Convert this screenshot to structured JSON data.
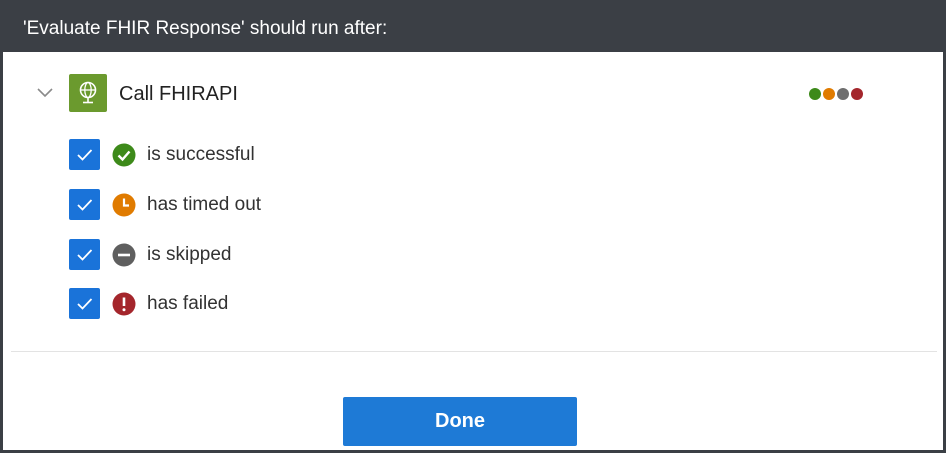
{
  "dialog": {
    "title": "'Evaluate FHIR Response' should run after:"
  },
  "action": {
    "name": "Call FHIRAPI",
    "icon": "globe-icon",
    "icon_color": "#6b9a2e",
    "status_dot_colors": [
      "#3d8a1a",
      "#e07b00",
      "#6e6e6e",
      "#a4262c"
    ]
  },
  "run_after_options": [
    {
      "label": "is successful",
      "checked": true,
      "icon": "success-check-icon",
      "color": "#3d8a1a"
    },
    {
      "label": "has timed out",
      "checked": true,
      "icon": "timeout-clock-icon",
      "color": "#e07b00"
    },
    {
      "label": "is skipped",
      "checked": true,
      "icon": "skipped-minus-icon",
      "color": "#5f5f5f"
    },
    {
      "label": "has failed",
      "checked": true,
      "icon": "failed-exclamation-icon",
      "color": "#a4262c"
    }
  ],
  "footer": {
    "done_label": "Done"
  },
  "colors": {
    "header_bg": "#3b3f45",
    "primary_button": "#1e7ad6",
    "checkbox": "#1a73d9"
  }
}
